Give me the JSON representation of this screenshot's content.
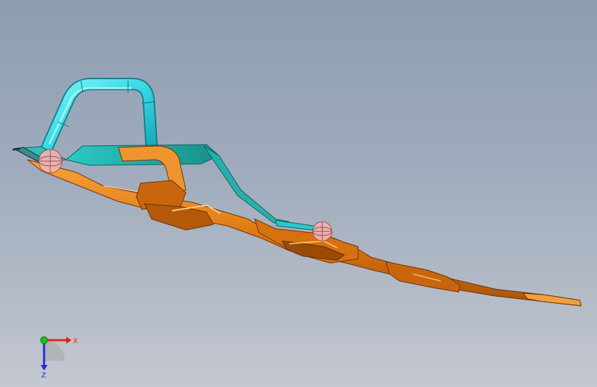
{
  "viewport": {
    "background_top": "#8e9db2",
    "background_bottom": "#c4c8cf"
  },
  "model": {
    "cyan_color": "#33d9e0",
    "teal_color": "#1fb5b0",
    "orange_color": "#e07a12",
    "orange_dark": "#9c4a05",
    "marker_color": "#f2a8a8"
  },
  "triad": {
    "x_label": "X",
    "z_label": "Z",
    "x_color": "#e0201e",
    "y_color": "#19c419",
    "z_color": "#1f2bd6"
  }
}
